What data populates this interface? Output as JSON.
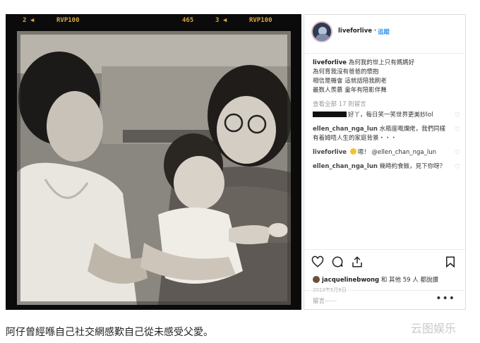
{
  "film_strip": {
    "f1": "2 ◀",
    "f2": "RVP100",
    "f3": "465",
    "f4": "3 ◀",
    "f5": "RVP100"
  },
  "post": {
    "username": "liveforlive",
    "dot": "•",
    "follow_label": "追蹤",
    "caption_user": "liveforlive",
    "caption_lines": [
      "為何我的世上只有媽媽好",
      "為何育我沒有爸爸的懷抱",
      "相信是機會 這就話陪我刷老",
      "最数人羨慕 童年有陪影伴舞"
    ],
    "view_all": "查看全部 17 則留言",
    "comments": [
      {
        "user": "",
        "text": "好丫，每日笑一笑世界更美妙lol"
      },
      {
        "user": "ellen_chan_nga_lun",
        "text": "水瓶座嘅爛佬，我們同樣有着姆唔人生的家庭背景・・・"
      },
      {
        "user": "liveforlive",
        "text": "嗯！ @ellen_chan_nga_lun"
      },
      {
        "user": "ellen_chan_nga_lun",
        "text": "幾時約食飯，見下你呀？"
      }
    ],
    "likes_user": "jacquelinebwong",
    "likes_rest": "和 其他 59 人 都說讚",
    "date": "2013年5月9日",
    "comment_placeholder": "留言⋯⋯",
    "more_icon": "•••",
    "heart_icon": "♡"
  },
  "article_text": "阿仔曾經喺自己社交網感歎自己從未感受父愛。",
  "watermark": "云图娱乐",
  "colors": {
    "link": "#3897f0",
    "film": "#0b0b0b",
    "film_text": "#d9a441"
  }
}
